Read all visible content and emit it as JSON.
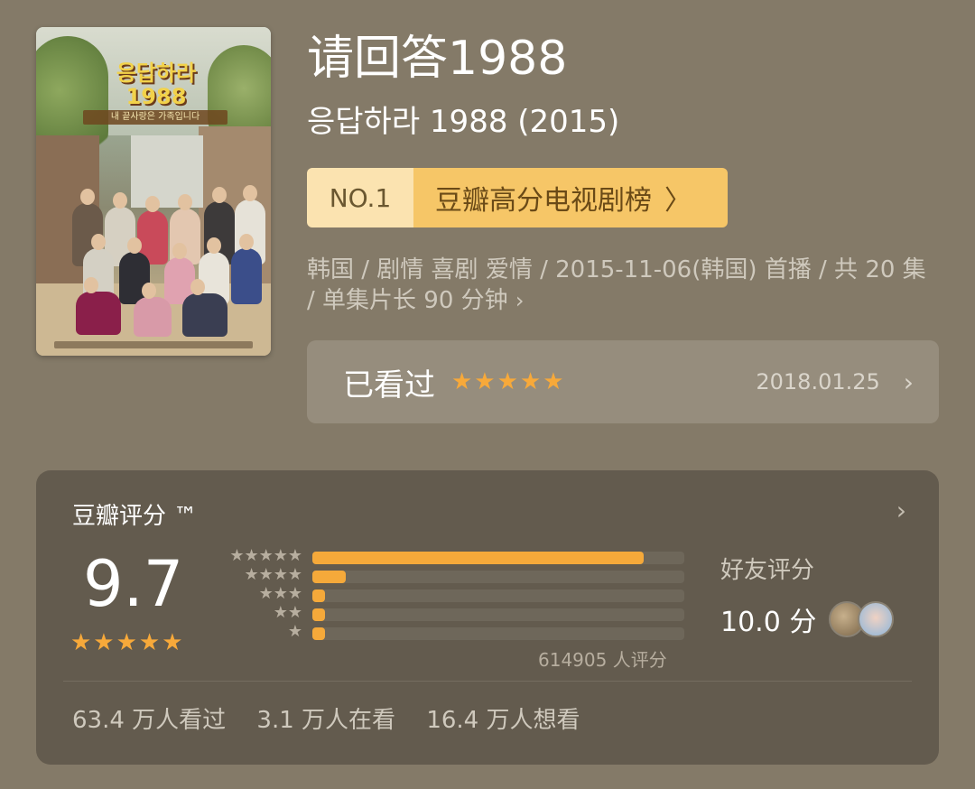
{
  "title": "请回答1988",
  "original_title": "응답하라 1988 (2015)",
  "poster": {
    "logo": "응답하라\n1988",
    "tagline": "내 끝사랑은 가족입니다"
  },
  "rank": {
    "no": "NO.1",
    "board": "豆瓣高分电视剧榜",
    "chevron": "〉"
  },
  "meta": {
    "text": "韩国 / 剧情 喜剧 爱情 / 2015-11-06(韩国) 首播 / 共 20 集 / 单集片长 90 分钟",
    "chevron": "›"
  },
  "watched": {
    "status": "已看过",
    "stars": "★★★★★",
    "date": "2018.01.25",
    "chevron": "›"
  },
  "rating": {
    "header": "豆瓣评分 ™",
    "chevron": "›",
    "score": "9.7",
    "stars": "★★★★★",
    "distribution": [
      {
        "label": "★★★★★",
        "fraction": 0.89
      },
      {
        "label": "★★★★",
        "fraction": 0.09
      },
      {
        "label": "★★★",
        "fraction": 0.035
      },
      {
        "label": "★★",
        "fraction": 0.035
      },
      {
        "label": "★",
        "fraction": 0.035
      }
    ],
    "count": "614905 人评分",
    "friends_label": "好友评分",
    "friends_score": "10.0 分"
  },
  "stats": {
    "watched": "63.4 万人看过",
    "watching": "3.1 万人在看",
    "wish": "16.4 万人想看"
  },
  "colors": {
    "background": "#847a68",
    "card": "#635b4e",
    "star": "#f7a93a",
    "rank_light": "#fbe3b0",
    "rank_dark": "#f6c667"
  }
}
